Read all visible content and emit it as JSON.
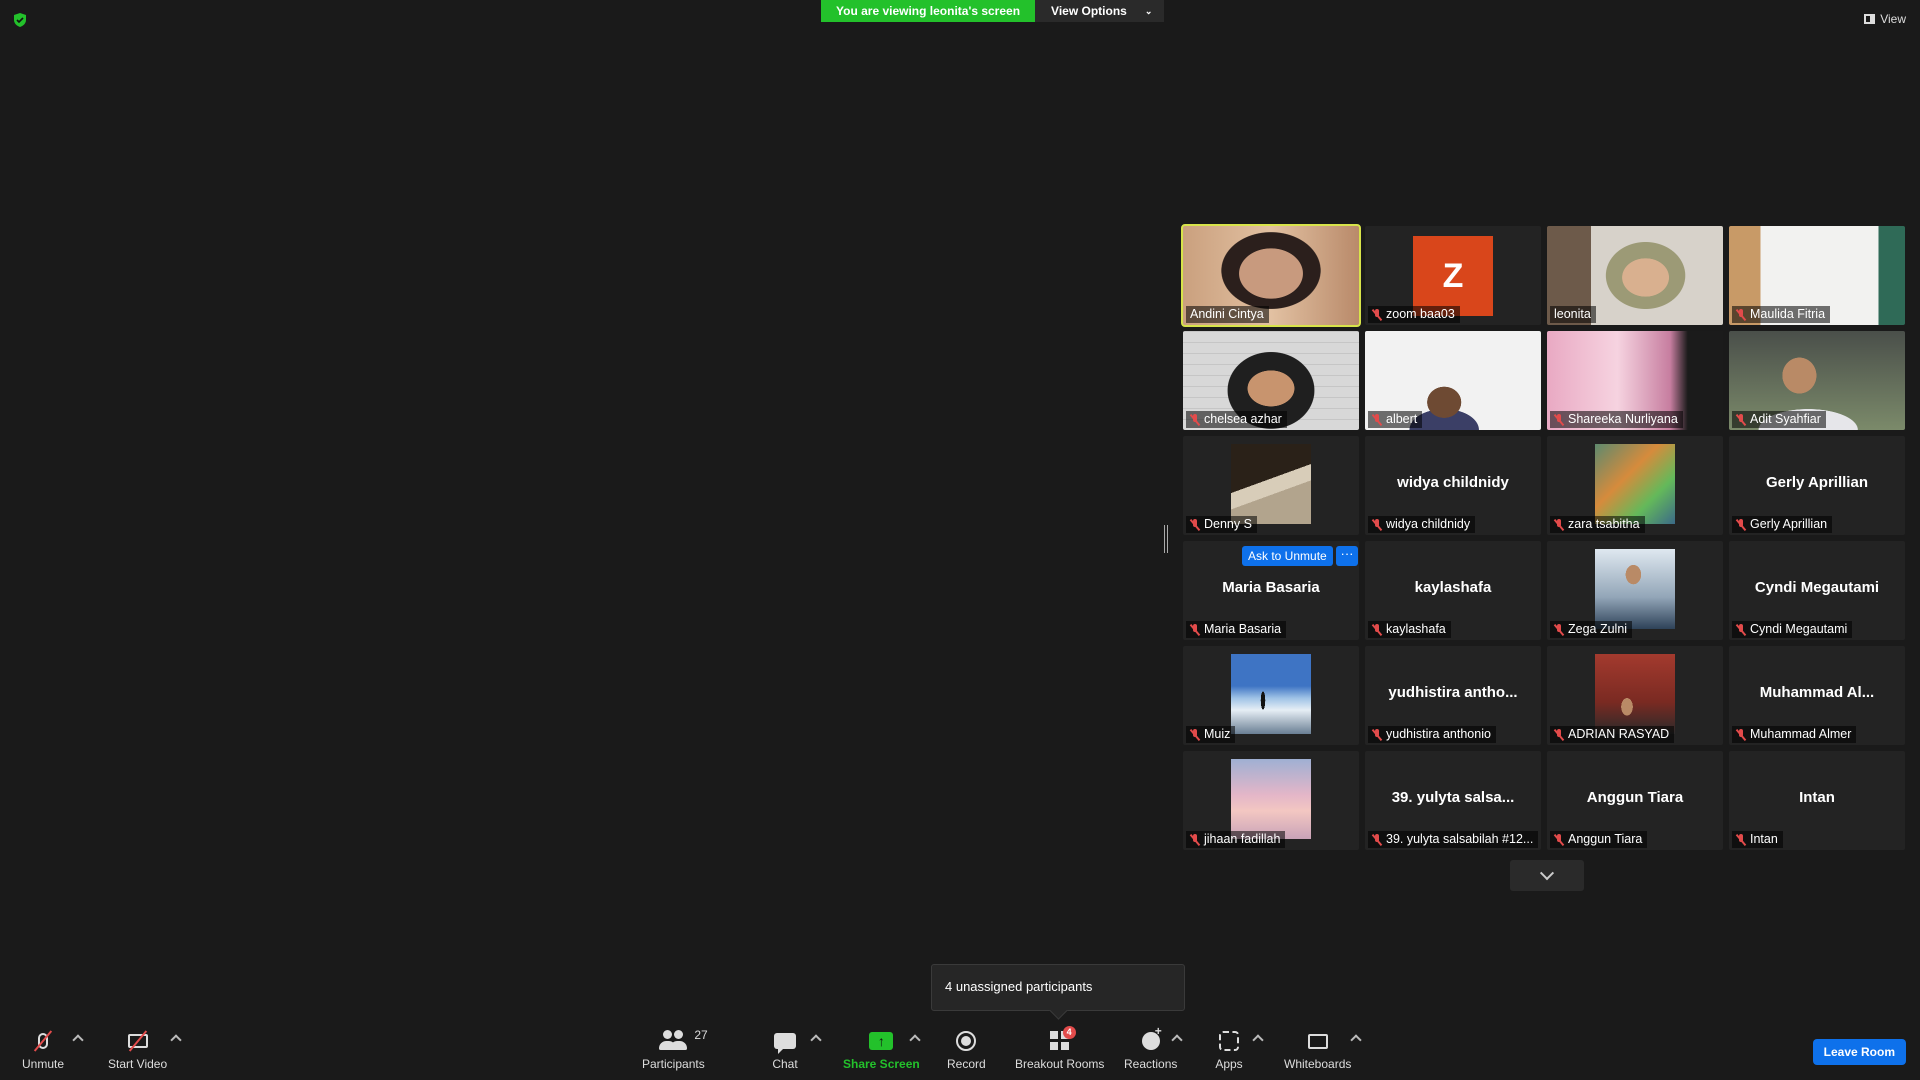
{
  "top": {
    "viewing_text": "You are viewing leonita's screen",
    "view_options_label": "View Options",
    "view_label": "View"
  },
  "gallery": [
    {
      "name": "Andini Cintya",
      "big": "",
      "muted": false,
      "photo": "andini",
      "active": true
    },
    {
      "name": "zoom baa03",
      "big": "",
      "muted": true,
      "photo": "zoom",
      "avatar_letter": "Z"
    },
    {
      "name": "leonita",
      "big": "",
      "muted": false,
      "photo": "leonita"
    },
    {
      "name": "Maulida Fitria",
      "big": "",
      "muted": true,
      "photo": "maulida"
    },
    {
      "name": "chelsea azhar",
      "big": "",
      "muted": true,
      "photo": "chelsea"
    },
    {
      "name": "albert",
      "big": "",
      "muted": true,
      "photo": "albert"
    },
    {
      "name": "Shareeka Nurliyana",
      "big": "",
      "muted": true,
      "photo": "shareeka"
    },
    {
      "name": "Adit Syahfiar",
      "big": "",
      "muted": true,
      "photo": "adit"
    },
    {
      "name": "Denny S",
      "big": "",
      "muted": true,
      "photo": "denny"
    },
    {
      "name": "widya childnidy",
      "big": "widya childnidy",
      "muted": true,
      "photo": ""
    },
    {
      "name": "zara tsabitha",
      "big": "",
      "muted": true,
      "photo": "zara"
    },
    {
      "name": "Gerly Aprillian",
      "big": "Gerly Aprillian",
      "muted": true,
      "photo": ""
    },
    {
      "name": "Maria Basaria",
      "big": "Maria Basaria",
      "muted": true,
      "photo": ""
    },
    {
      "name": "kaylashafa",
      "big": "kaylashafa",
      "muted": true,
      "photo": ""
    },
    {
      "name": "Zega Zulni",
      "big": "",
      "muted": true,
      "photo": "zega"
    },
    {
      "name": "Cyndi Megautami",
      "big": "Cyndi Megautami",
      "muted": true,
      "photo": ""
    },
    {
      "name": "Muiz",
      "big": "",
      "muted": true,
      "photo": "muiz"
    },
    {
      "name": "yudhistira anthonio",
      "big": "yudhistira antho...",
      "muted": true,
      "photo": ""
    },
    {
      "name": "ADRIAN RASYAD",
      "big": "",
      "muted": true,
      "photo": "adrian"
    },
    {
      "name": "Muhammad Almer",
      "big": "Muhammad Al...",
      "muted": true,
      "photo": ""
    },
    {
      "name": "jihaan fadillah",
      "big": "",
      "muted": true,
      "photo": "jihaan"
    },
    {
      "name": "39. yulyta salsabilah #12...",
      "big": "39. yulyta salsa...",
      "muted": true,
      "photo": ""
    },
    {
      "name": "Anggun Tiara",
      "big": "Anggun Tiara",
      "muted": true,
      "photo": ""
    },
    {
      "name": "Intan",
      "big": "Intan",
      "muted": true,
      "photo": ""
    }
  ],
  "hover": {
    "ask_to_unmute": "Ask to Unmute",
    "more": "···"
  },
  "popup": {
    "text": "4 unassigned participants"
  },
  "toolbar": {
    "unmute": "Unmute",
    "start_video": "Start Video",
    "participants": "Participants",
    "participants_count": "27",
    "chat": "Chat",
    "share_screen": "Share Screen",
    "record": "Record",
    "breakout_rooms": "Breakout Rooms",
    "breakout_badge": "4",
    "reactions": "Reactions",
    "apps": "Apps",
    "whiteboards": "Whiteboards",
    "leave_room": "Leave Room"
  },
  "colors": {
    "background": "#1a1a1a",
    "share_green": "#23c12b",
    "accent_blue": "#0e71eb",
    "active_speaker": "#d7e34a",
    "muted_red": "#e24b4b"
  }
}
